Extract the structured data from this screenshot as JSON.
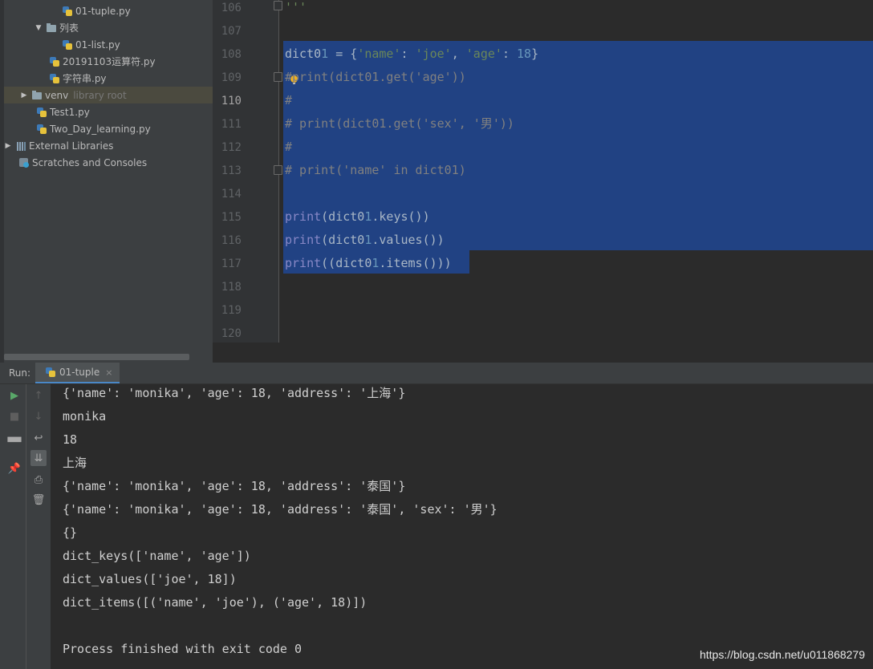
{
  "project_tree": {
    "items": [
      {
        "label": "01-tuple.py",
        "type": "py"
      },
      {
        "label": "列表",
        "type": "folder",
        "expanded": true
      },
      {
        "label": "01-list.py",
        "type": "py"
      },
      {
        "label": "20191103运算符.py",
        "type": "py"
      },
      {
        "label": "字符串.py",
        "type": "py"
      },
      {
        "label": "venv",
        "type": "folder",
        "note": "library root"
      },
      {
        "label": "Test1.py",
        "type": "py"
      },
      {
        "label": "Two_Day_learning.py",
        "type": "py"
      },
      {
        "label": "External Libraries",
        "type": "lib"
      },
      {
        "label": "Scratches and Consoles",
        "type": "scratch"
      }
    ]
  },
  "editor": {
    "line_numbers": [
      "106",
      "107",
      "108",
      "109",
      "110",
      "111",
      "112",
      "113",
      "114",
      "115",
      "116",
      "117",
      "118",
      "119",
      "120"
    ],
    "current_line": "110",
    "lines": [
      "'''",
      "",
      "dict01 = {'name': 'joe', 'age': 18}",
      "#print(dict01.get('age'))",
      "#",
      "# print(dict01.get('sex', '男'))",
      "#",
      "# print('name' in dict01)",
      "",
      "print(dict01.keys())",
      "print(dict01.values())",
      "print((dict01.items()))",
      "",
      "",
      ""
    ]
  },
  "run_panel": {
    "label": "Run:",
    "tab_name": "01-tuple",
    "close_glyph": "×",
    "tools": [
      "run-icon",
      "stop-icon",
      "layout-icon",
      "pin-icon",
      "up-arrow-icon",
      "down-arrow-icon",
      "soft-wrap-icon",
      "scroll-to-end-icon",
      "print-icon",
      "trash-icon"
    ],
    "output": [
      "{'name': 'monika', 'age': 18, 'address': '上海'}",
      "monika",
      "18",
      "上海",
      "{'name': 'monika', 'age': 18, 'address': '泰国'}",
      "{'name': 'monika', 'age': 18, 'address': '泰国', 'sex': '男'}",
      "{}",
      "dict_keys(['name', 'age'])",
      "dict_values(['joe', 18])",
      "dict_items([('name', 'joe'), ('age', 18)])",
      "",
      "Process finished with exit code 0"
    ]
  },
  "watermark": "https://blog.csdn.net/u011868279",
  "colors": {
    "selection": "#214283",
    "string": "#6a8759",
    "number": "#6897bb",
    "comment": "#808080",
    "builtin": "#8888c6"
  }
}
